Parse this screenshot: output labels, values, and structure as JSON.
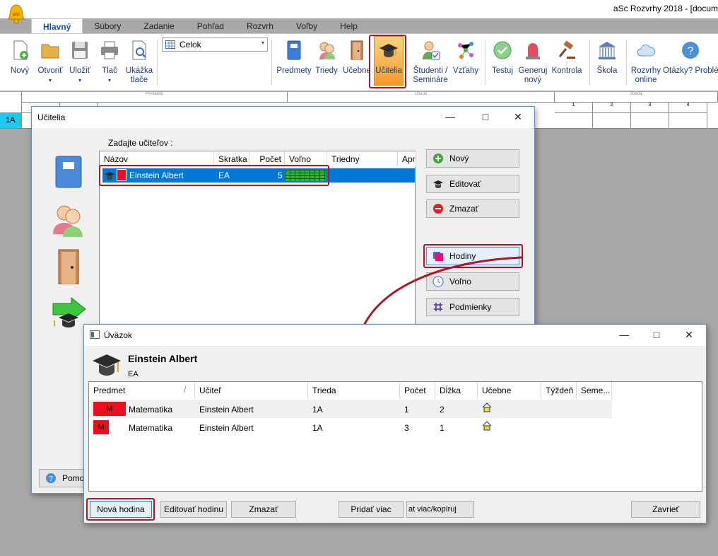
{
  "app": {
    "title": "aSc Rozvrhy 2018 - [docum"
  },
  "tabs": [
    {
      "label": "Hlavný",
      "active": true
    },
    {
      "label": "Súbory"
    },
    {
      "label": "Zadanie"
    },
    {
      "label": "Pohľad"
    },
    {
      "label": "Rozvrh"
    },
    {
      "label": "Voľby"
    },
    {
      "label": "Help"
    }
  ],
  "ribbon": {
    "novy": "Nový",
    "otvorit": "Otvoriť",
    "ulozit": "Uložiť",
    "tlac": "Tlač",
    "ukazka": "Ukážka tlače",
    "celok_select": "Celok",
    "predmety": "Predmety",
    "triedy": "Triedy",
    "ucebne": "Učebne",
    "ucitelia": "Učitelia",
    "studenti": "Študenti / Semináre",
    "vztahy": "Vzťahy",
    "testuj": "Testuj",
    "generuj": "Generuj nový",
    "kontrola": "Kontrola",
    "skola": "Škola",
    "rozvrhy_online": "Rozvrhy online",
    "otazky": "Otázky? Problé Napíšte nám",
    "dropdown_arrow": "▾"
  },
  "timetable": {
    "days": [
      "Pondelok",
      "Utorok",
      "Streda"
    ],
    "periods": [
      "1",
      "2",
      "3",
      "4"
    ],
    "row_label": "1A"
  },
  "ucitelia_dialog": {
    "title": "Učitelia",
    "prompt": "Zadajte učiteľov :",
    "columns": [
      "Názov",
      "Skratka",
      "Počet",
      "Voľno",
      "Triedny",
      "Apro"
    ],
    "rows": [
      {
        "name": "Einstein Albert",
        "short": "EA",
        "count": "5",
        "color": "#e8101e"
      }
    ],
    "buttons": {
      "novy": "Nový",
      "editovat": "Editovať",
      "zmazat": "Zmazať",
      "hodiny": "Hodiny",
      "volno": "Voľno",
      "podmienky": "Podmienky"
    },
    "help": "Pomoc"
  },
  "uvazok_dialog": {
    "title": "Úväzok",
    "teacher_name": "Einstein Albert",
    "teacher_short": "EA",
    "columns": [
      "Predmet",
      "Učiteľ",
      "Trieda",
      "Počet",
      "Dĺžka",
      "Učebne",
      "Týždeň",
      "Seme..."
    ],
    "rows": [
      {
        "badge": "M",
        "subject": "Matematika",
        "teacher": "Einstein Albert",
        "class": "1A",
        "count": "1",
        "length": "2"
      },
      {
        "badge": "M",
        "subject": "Matematika",
        "teacher": "Einstein Albert",
        "class": "1A",
        "count": "3",
        "length": "1"
      }
    ],
    "buttons": {
      "nova_hodina": "Nová hodina",
      "editovat_hodinu": "Editovať hodinu",
      "zmazat": "Zmazať",
      "pridat_viac": "Pridať viac",
      "kopiruj": "at viac/kopíruj",
      "zavriet": "Zavrieť"
    }
  },
  "colors": {
    "accent": "#1b4f9c",
    "highlight": "#a81a2a",
    "selection": "#0078d7",
    "subject_red": "#e8101e"
  }
}
